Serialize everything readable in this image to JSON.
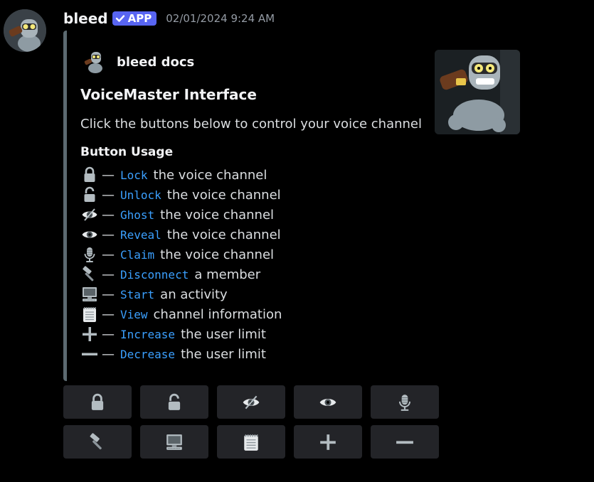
{
  "message": {
    "username": "bleed",
    "badge_label": "APP",
    "timestamp": "02/01/2024 9:24 AM"
  },
  "embed": {
    "author": "bleed docs",
    "title": "VoiceMaster Interface",
    "description": "Click the buttons below to control your voice channel",
    "usage_title": "Button Usage",
    "accent_color": "#5c6a71",
    "usage": [
      {
        "icon": "lock-icon",
        "command": "Lock",
        "text": "the voice channel"
      },
      {
        "icon": "unlock-icon",
        "command": "Unlock",
        "text": "the voice channel"
      },
      {
        "icon": "eye-hidden-icon",
        "command": "Ghost",
        "text": "the voice channel"
      },
      {
        "icon": "eye-icon",
        "command": "Reveal",
        "text": "the voice channel"
      },
      {
        "icon": "microphone-icon",
        "command": "Claim",
        "text": "the voice channel"
      },
      {
        "icon": "hammer-icon",
        "command": "Disconnect",
        "text": "a member"
      },
      {
        "icon": "computer-icon",
        "command": "Start",
        "text": "an activity"
      },
      {
        "icon": "notepad-icon",
        "command": "View",
        "text": "channel information"
      },
      {
        "icon": "plus-icon",
        "command": "Increase",
        "text": "the user limit"
      },
      {
        "icon": "minus-icon",
        "command": "Decrease",
        "text": "the user limit"
      }
    ]
  },
  "buttons": [
    "lock-icon",
    "unlock-icon",
    "eye-hidden-icon",
    "eye-icon",
    "microphone-icon",
    "hammer-icon",
    "computer-icon",
    "notepad-icon",
    "plus-icon",
    "minus-icon"
  ],
  "colors": {
    "badge": "#5865f2",
    "code": "#3ba0ff",
    "button_bg": "#232428"
  }
}
